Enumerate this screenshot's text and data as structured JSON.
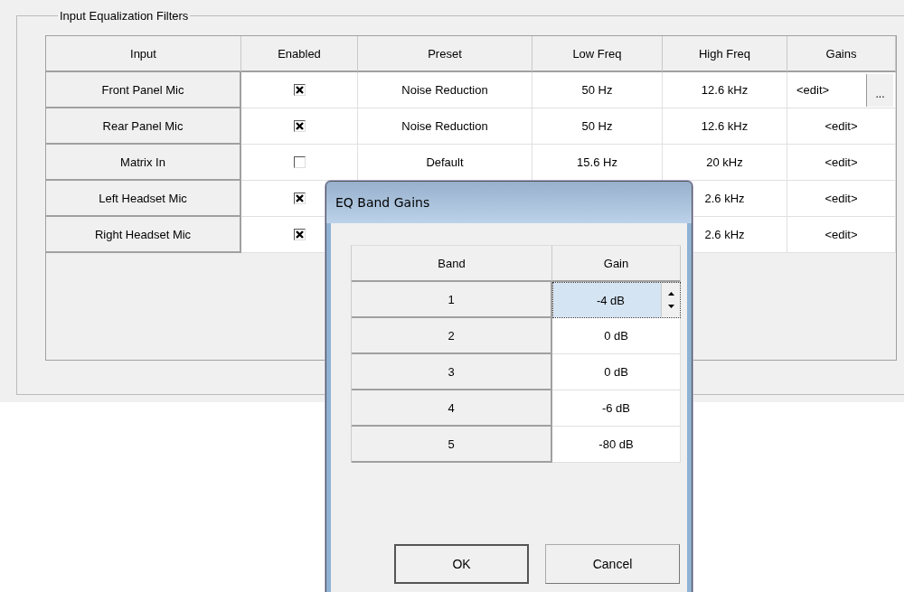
{
  "group": {
    "title": "Input Equalization Filters"
  },
  "table": {
    "columns": [
      "Input",
      "Enabled",
      "Preset",
      "Low Freq",
      "High Freq",
      "Gains"
    ],
    "rows": [
      {
        "input": "Front Panel Mic",
        "enabled": true,
        "preset": "Noise Reduction",
        "low_freq": "50 Hz",
        "high_freq": "12.6 kHz",
        "gains": "<edit>",
        "gains_button": "..."
      },
      {
        "input": "Rear Panel Mic",
        "enabled": true,
        "preset": "Noise Reduction",
        "low_freq": "50 Hz",
        "high_freq": "12.6 kHz",
        "gains": "<edit>"
      },
      {
        "input": "Matrix In",
        "enabled": false,
        "preset": "Default",
        "low_freq": "15.6 Hz",
        "high_freq": "20 kHz",
        "gains": "<edit>"
      },
      {
        "input": "Left Headset Mic",
        "enabled": true,
        "high_freq": "2.6 kHz",
        "gains": "<edit>"
      },
      {
        "input": "Right Headset Mic",
        "enabled": true,
        "high_freq": "2.6 kHz",
        "gains": "<edit>"
      }
    ]
  },
  "dialog": {
    "title": "EQ Band Gains",
    "columns": [
      "Band",
      "Gain"
    ],
    "rows": [
      {
        "band": "1",
        "gain": "-4 dB",
        "selected": true
      },
      {
        "band": "2",
        "gain": "0 dB",
        "selected": false
      },
      {
        "band": "3",
        "gain": "0 dB",
        "selected": false
      },
      {
        "band": "4",
        "gain": "-6 dB",
        "selected": false
      },
      {
        "band": "5",
        "gain": "-80 dB",
        "selected": false
      }
    ],
    "buttons": [
      "OK",
      "Cancel"
    ]
  }
}
